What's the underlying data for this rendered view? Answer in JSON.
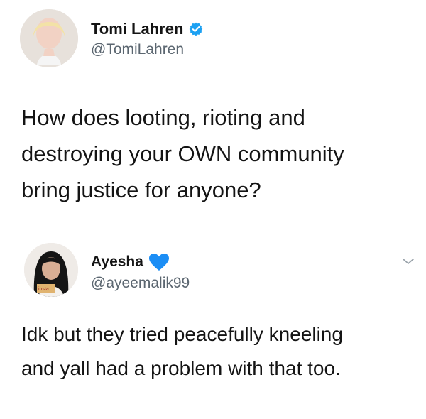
{
  "main_tweet": {
    "author_name": "Tomi Lahren",
    "handle": "@TomiLahren",
    "verified_icon": "verified-badge-icon",
    "text": "How does looting, rioting and\ndestroying your OWN community\nbring justice for anyone?"
  },
  "reply_tweet": {
    "author_name": "Ayesha",
    "handle": "@ayeemalik99",
    "emoji_icon": "blue-heart-icon",
    "menu_icon": "chevron-down-icon",
    "text": "Idk but they tried peacefully kneeling\nand yall had a problem with that too."
  },
  "colors": {
    "verified_blue": "#1da1f2",
    "heart_blue": "#1c8ef5",
    "handle_gray": "#5b6670",
    "text_dark": "#141414"
  }
}
